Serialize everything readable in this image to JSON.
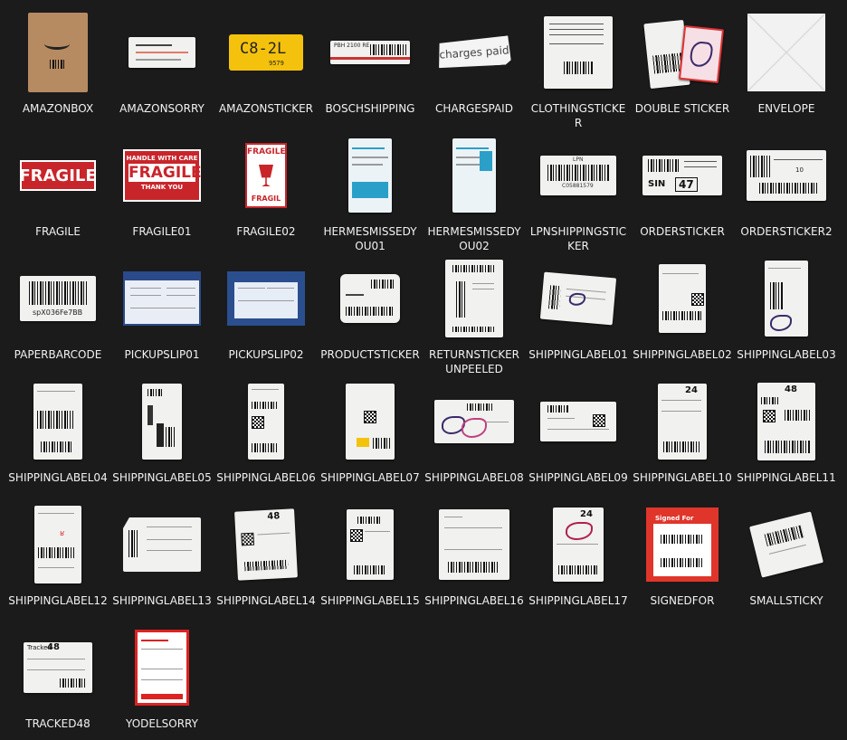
{
  "files": [
    {
      "name": "AMAZONBOX",
      "icon": "cardboard-box-icon"
    },
    {
      "name": "AMAZONSORRY",
      "icon": "sticker-icon"
    },
    {
      "name": "AMAZONSTICKER",
      "icon": "yellow-sticker-icon",
      "text_main": "C8-2L",
      "text_sub": "9579"
    },
    {
      "name": "BOSCHSHIPPING",
      "icon": "shipping-label-icon",
      "text_main": "PBH 2100 RE"
    },
    {
      "name": "CHARGESPAID",
      "icon": "sticker-icon",
      "text_main": "charges paid"
    },
    {
      "name": "CLOTHINGSTICKER",
      "icon": "sticker-icon"
    },
    {
      "name": "DOUBLE STICKER",
      "icon": "sticker-icon"
    },
    {
      "name": "ENVELOPE",
      "icon": "envelope-icon"
    },
    {
      "name": "FRAGILE",
      "icon": "fragile-sticker-icon",
      "text_main": "FRAGILE"
    },
    {
      "name": "FRAGILE01",
      "icon": "fragile-sticker-icon",
      "text_top": "HANDLE WITH CARE",
      "text_main": "FRAGILE",
      "text_bottom": "THANK YOU"
    },
    {
      "name": "FRAGILE02",
      "icon": "fragile-sticker-icon",
      "text_main": "FRAGILE",
      "text_bottom": "FRAGIL"
    },
    {
      "name": "HERMESMISSEDYOU01",
      "icon": "missed-card-icon"
    },
    {
      "name": "HERMESMISSEDYOU02",
      "icon": "missed-card-icon"
    },
    {
      "name": "LPNSHIPPINGSTICKER",
      "icon": "barcode-sticker-icon",
      "text_top": "LPN",
      "text_main": "C05881579"
    },
    {
      "name": "ORDERSTICKER",
      "icon": "barcode-sticker-icon",
      "text_main": "SIN",
      "text_sub": "47"
    },
    {
      "name": "ORDERSTICKER2",
      "icon": "barcode-sticker-icon",
      "text_main": "10"
    },
    {
      "name": "PAPERBARCODE",
      "icon": "barcode-sticker-icon",
      "text_main": "spX036Fe7BB"
    },
    {
      "name": "PICKUPSLIP01",
      "icon": "slip-icon"
    },
    {
      "name": "PICKUPSLIP02",
      "icon": "slip-icon"
    },
    {
      "name": "PRODUCTSTICKER",
      "icon": "product-sticker-icon"
    },
    {
      "name": "RETURNSTICKER UNPEELED",
      "icon": "shipping-label-icon"
    },
    {
      "name": "SHIPPINGLABEL01",
      "icon": "shipping-label-icon"
    },
    {
      "name": "SHIPPINGLABEL02",
      "icon": "shipping-label-icon"
    },
    {
      "name": "SHIPPINGLABEL03",
      "icon": "shipping-label-icon"
    },
    {
      "name": "SHIPPINGLABEL04",
      "icon": "shipping-label-icon"
    },
    {
      "name": "SHIPPINGLABEL05",
      "icon": "shipping-label-icon"
    },
    {
      "name": "SHIPPINGLABEL06",
      "icon": "shipping-label-icon"
    },
    {
      "name": "SHIPPINGLABEL07",
      "icon": "shipping-label-icon"
    },
    {
      "name": "SHIPPINGLABEL08",
      "icon": "shipping-label-icon"
    },
    {
      "name": "SHIPPINGLABEL09",
      "icon": "shipping-label-icon"
    },
    {
      "name": "SHIPPINGLABEL10",
      "icon": "shipping-label-icon",
      "text_main": "24"
    },
    {
      "name": "SHIPPINGLABEL11",
      "icon": "shipping-label-icon",
      "text_main": "48"
    },
    {
      "name": "SHIPPINGLABEL12",
      "icon": "shipping-label-icon"
    },
    {
      "name": "SHIPPINGLABEL13",
      "icon": "shipping-label-icon"
    },
    {
      "name": "SHIPPINGLABEL14",
      "icon": "shipping-label-icon",
      "text_main": "48"
    },
    {
      "name": "SHIPPINGLABEL15",
      "icon": "shipping-label-icon"
    },
    {
      "name": "SHIPPINGLABEL16",
      "icon": "shipping-label-icon"
    },
    {
      "name": "SHIPPINGLABEL17",
      "icon": "shipping-label-icon",
      "text_main": "24"
    },
    {
      "name": "SIGNEDFOR",
      "icon": "signed-for-label-icon",
      "text_main": "Signed For"
    },
    {
      "name": "SMALLSTICKY",
      "icon": "barcode-sticker-icon"
    },
    {
      "name": "TRACKED48",
      "icon": "shipping-label-icon",
      "text_top": "Tracked",
      "text_main": "48"
    },
    {
      "name": "YODELSORRY",
      "icon": "missed-card-icon"
    }
  ]
}
